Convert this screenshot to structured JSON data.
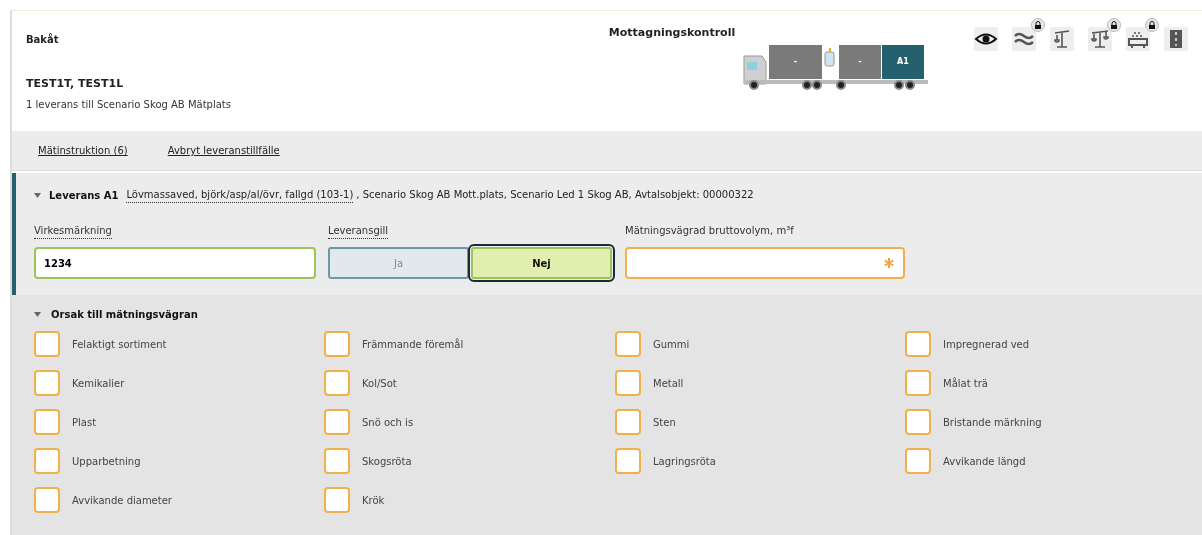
{
  "header": {
    "back": "Bakåt",
    "title": "Mottagningskontroll",
    "vehicle": "TEST1T, TEST1L",
    "subtitle": "1 leverans till Scenario Skog AB Mätplats"
  },
  "truck": {
    "loads": [
      {
        "label": "-",
        "selected": false
      },
      {
        "label": "-",
        "selected": false
      },
      {
        "label": "A1",
        "selected": true
      }
    ]
  },
  "tools": [
    {
      "kind": "eye",
      "locked": false
    },
    {
      "kind": "wave",
      "locked": true
    },
    {
      "kind": "crane",
      "locked": false
    },
    {
      "kind": "scale",
      "locked": true
    },
    {
      "kind": "cart",
      "locked": true
    },
    {
      "kind": "road",
      "locked": false
    }
  ],
  "actions": [
    "Mätinstruktion (6)",
    "Avbryt leveranstillfälle"
  ],
  "delivery": {
    "title": "Leverans A1",
    "expanded": true,
    "assortment": "Lövmassaved, björk/asp/al/övr, fallgd (103-1)",
    "details": ", Scenario Skog AB Mott.plats, Scenario Led 1 Skog AB, Avtalsobjekt: 00000322",
    "marking": {
      "label": "Virkesmärkning",
      "value": "1234"
    },
    "fee": {
      "label": "Leveransgill",
      "options": [
        {
          "label": "Ja",
          "selected": false
        },
        {
          "label": "Nej",
          "selected": true
        }
      ]
    },
    "volume": {
      "label": "Mätningsvägrad bruttovolym, m³f",
      "required": true
    }
  },
  "reasons": {
    "title": "Orsak till mätningsvägran",
    "expanded": true,
    "items": [
      {
        "label": "Felaktigt sortiment",
        "checked": false
      },
      {
        "label": "Främmande föremål",
        "checked": false
      },
      {
        "label": "Gummi",
        "checked": false
      },
      {
        "label": "Impregnerad ved",
        "checked": false
      },
      {
        "label": "Kemikalier",
        "checked": false
      },
      {
        "label": "Kol/Sot",
        "checked": false
      },
      {
        "label": "Metall",
        "checked": false
      },
      {
        "label": "Målat trä",
        "checked": false
      },
      {
        "label": "Plast",
        "checked": false
      },
      {
        "label": "Snö och is",
        "checked": false
      },
      {
        "label": "Sten",
        "checked": false
      },
      {
        "label": "Bristande märkning",
        "checked": false
      },
      {
        "label": "Upparbetning",
        "checked": false
      },
      {
        "label": "Skogsröta",
        "checked": false
      },
      {
        "label": "Lagringsröta",
        "checked": false
      },
      {
        "label": "Avvikande längd",
        "checked": false
      },
      {
        "label": "Avvikande diameter",
        "checked": false
      },
      {
        "label": "Krök",
        "checked": false
      }
    ]
  }
}
